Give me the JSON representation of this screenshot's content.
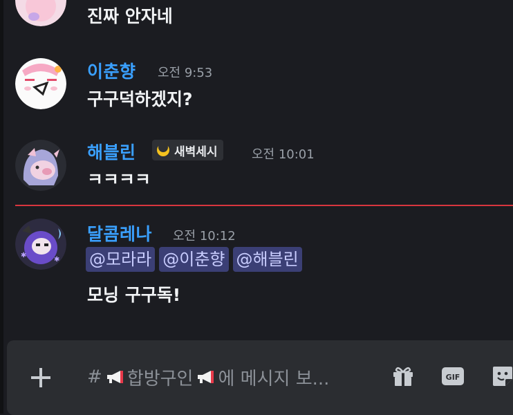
{
  "messages": [
    {
      "author": "",
      "time": "",
      "text": "진짜 안자네"
    },
    {
      "author": "이춘향",
      "time": "오전 9:53",
      "text": "구구덕하겠지?"
    },
    {
      "author": "해블린",
      "role_badge": "새벽세시",
      "time": "오전 10:01",
      "text": "ㅋㅋㅋㅋ"
    },
    {
      "author": "달콤레나",
      "time": "오전 10:12",
      "mentions": [
        "@모라라",
        "@이춘향",
        "@해블린"
      ],
      "text": "모닝 구구독!"
    }
  ],
  "composer": {
    "channel_prefix": "#",
    "channel_name": "합방구인",
    "placeholder_suffix": "에 메시지 보...",
    "icons": [
      "add-icon",
      "megaphone-icon",
      "gift-icon",
      "gif-icon",
      "sticker-icon"
    ]
  },
  "colors": {
    "username": "#3aa0ff",
    "mention_bg": "#3b3f75",
    "new_divider": "#d9363e",
    "background": "#1b1c21"
  }
}
